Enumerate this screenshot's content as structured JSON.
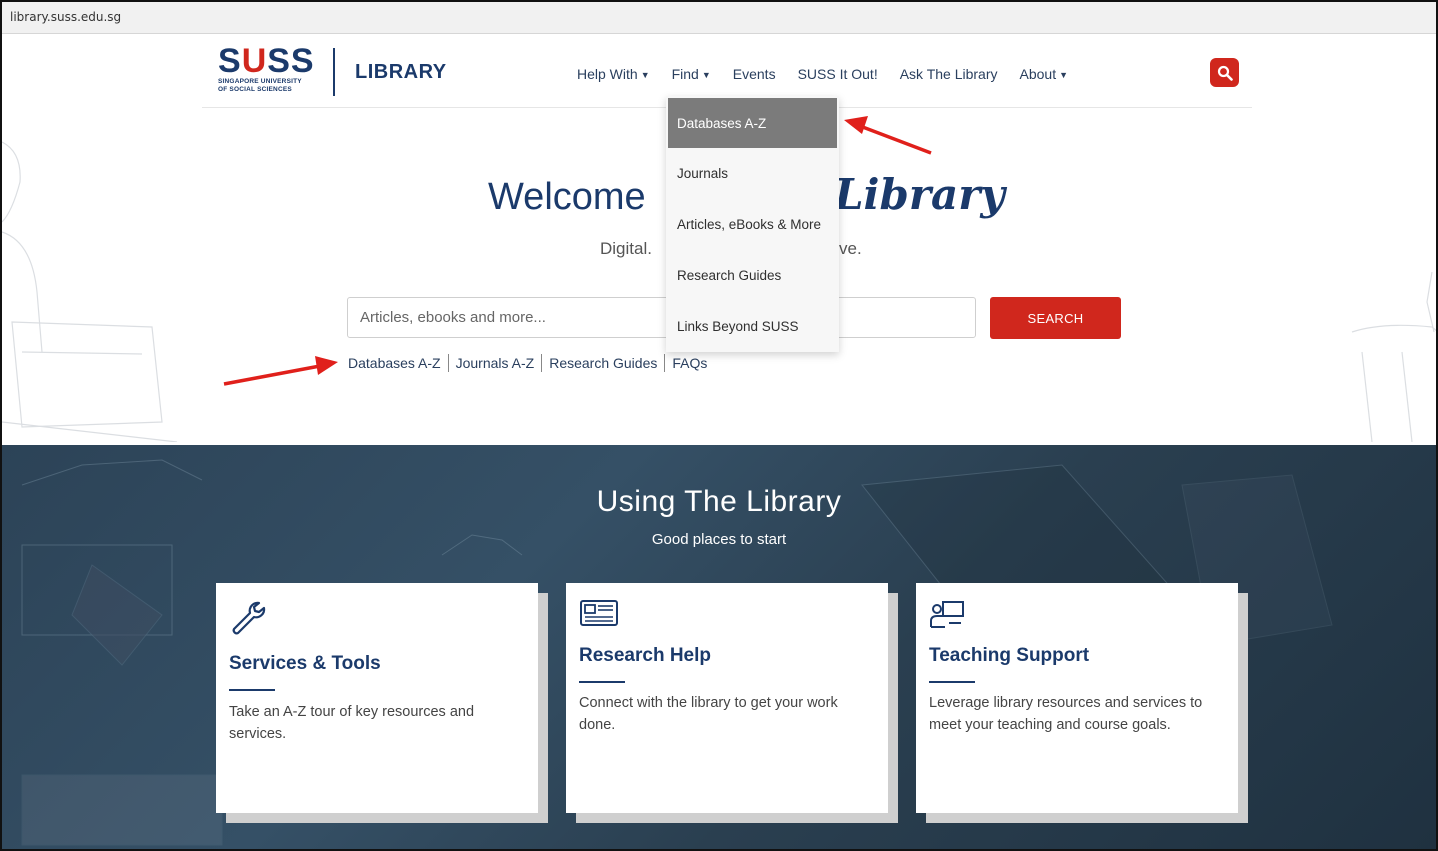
{
  "browser": {
    "url": "library.suss.edu.sg"
  },
  "header": {
    "logo_word_left": "S",
    "logo_word_mid": "U",
    "logo_word_right": "SS",
    "logo_sub_1": "SINGAPORE UNIVERSITY",
    "logo_sub_2": "OF SOCIAL SCIENCES",
    "library_label": "LIBRARY",
    "nav": [
      {
        "label": "Help With",
        "dropdown": true
      },
      {
        "label": "Find",
        "dropdown": true
      },
      {
        "label": "Events",
        "dropdown": false
      },
      {
        "label": "SUSS It Out!",
        "dropdown": false
      },
      {
        "label": "Ask The Library",
        "dropdown": false
      },
      {
        "label": "About",
        "dropdown": true
      }
    ],
    "search_icon": "search-icon"
  },
  "find_menu": {
    "items": [
      {
        "label": "Databases A-Z",
        "active": true
      },
      {
        "label": "Journals",
        "active": false
      },
      {
        "label": "Articles, eBooks & More",
        "active": false
      },
      {
        "label": "Research Guides",
        "active": false
      },
      {
        "label": "Links Beyond SUSS",
        "active": false
      }
    ]
  },
  "hero": {
    "welcome_visible": "Welcome",
    "welcome_script_visible": "Library",
    "tagline_left_visible": "Digital.",
    "tagline_right_visible": "ve.",
    "search_placeholder": "Articles, ebooks and more...",
    "search_button": "SEARCH",
    "quick_links": [
      "Databases A-Z",
      "Journals A-Z",
      "Research Guides",
      "FAQs"
    ]
  },
  "using": {
    "title": "Using The Library",
    "subtitle": "Good places to start",
    "cards": [
      {
        "icon": "wrench-icon",
        "title": "Services & Tools",
        "text": "Take an A-Z tour of key resources and services."
      },
      {
        "icon": "newspaper-icon",
        "title": "Research Help",
        "text": "Connect with the library to get your work done."
      },
      {
        "icon": "teacher-icon",
        "title": "Teaching Support",
        "text": "Leverage library resources and services to meet your teaching and course goals."
      }
    ]
  },
  "colors": {
    "brand_navy": "#1b3a6b",
    "brand_red": "#d0271d",
    "annotation_red": "#e0201b"
  }
}
